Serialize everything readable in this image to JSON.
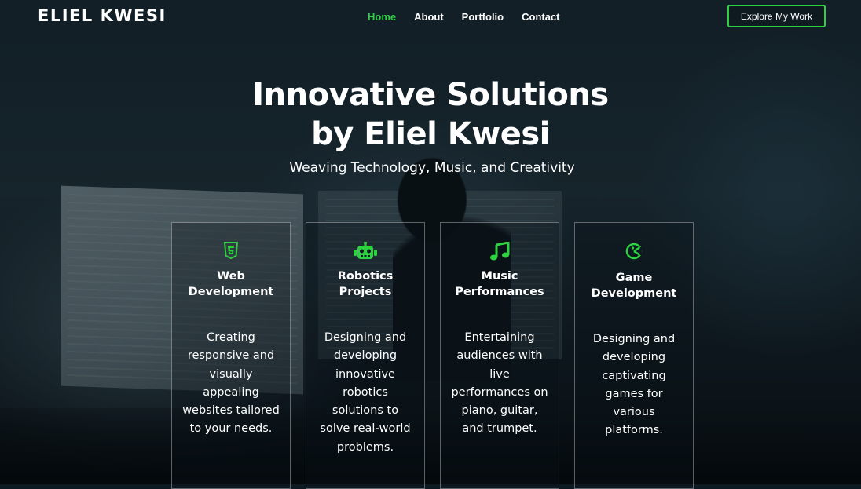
{
  "header": {
    "brand": "ELIEL KWESI",
    "nav": [
      {
        "label": "Home",
        "active": true
      },
      {
        "label": "About",
        "active": false
      },
      {
        "label": "Portfolio",
        "active": false
      },
      {
        "label": "Contact",
        "active": false
      }
    ],
    "cta_label": "Explore My Work"
  },
  "hero": {
    "title_line1": "Innovative Solutions",
    "title_line2": "by Eliel Kwesi",
    "subtitle": "Weaving Technology, Music, and Creativity"
  },
  "cards": [
    {
      "icon": "html5-icon",
      "title_line1": "Web",
      "title_line2": "Development",
      "description": "Creating responsive and visually appealing websites tailored to your needs."
    },
    {
      "icon": "robot-icon",
      "title_line1": "Robotics",
      "title_line2": "Projects",
      "description": "Designing and developing innovative robotics solutions to solve real-world problems."
    },
    {
      "icon": "music-note-icon",
      "title_line1": "Music",
      "title_line2": "Performances",
      "description": "Entertaining audiences with live performances on piano, guitar, and trumpet."
    },
    {
      "icon": "game-pacman-icon",
      "title_line1": "Game",
      "title_line2": "Development",
      "description": "Designing and developing captivating games for various platforms."
    }
  ],
  "colors": {
    "accent": "#2bd43f",
    "text": "#ffffff"
  }
}
